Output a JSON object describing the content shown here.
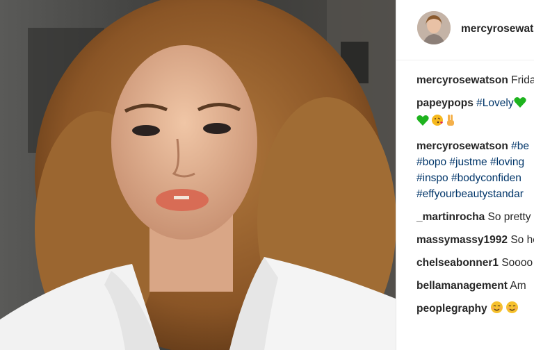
{
  "post": {
    "header": {
      "username": "mercyrosewatson"
    }
  },
  "comments": [
    {
      "user": "mercyrosewatson",
      "text": "Frida"
    },
    {
      "user": "papeypops",
      "tag": "#Lovely",
      "emojis": [
        "green-heart-icon"
      ],
      "line2_emojis": [
        "green-heart-icon",
        "face-blowing-kiss-icon",
        "victory-hand-icon"
      ]
    },
    {
      "user": "mercyrosewatson",
      "tags": [
        "#be",
        "#bopo #justme #loving",
        "#inspo #bodyconfiden",
        "#effyourbeautystandar"
      ]
    },
    {
      "user": "_martinrocha",
      "text": "So pretty"
    },
    {
      "user": "massymassy1992",
      "text": "So he"
    },
    {
      "user": "chelseabonner1",
      "text": "Soooo"
    },
    {
      "user": "bellamanagement",
      "text": "Am"
    },
    {
      "user": "peoplegraphy",
      "emojis": [
        "smiling-blush-face-icon",
        "smiling-blush-face-icon"
      ]
    }
  ],
  "colors": {
    "hashtag": "#003569",
    "text": "#262626",
    "green_heart": "#1eb31e",
    "kiss_face": "#f6b91e",
    "blush": "#f4a261"
  }
}
